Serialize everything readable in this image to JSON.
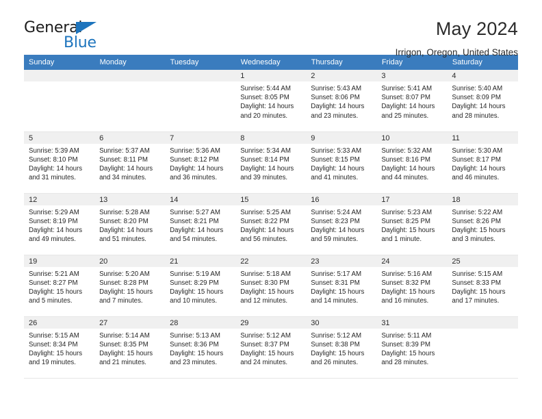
{
  "brand": {
    "name_part1": "General",
    "name_part2": "Blue",
    "accent_color": "#1d74bd"
  },
  "header": {
    "title": "May 2024",
    "subtitle": "Irrigon, Oregon, United States"
  },
  "calendar": {
    "header_bg": "#3a7cbe",
    "weekdays": [
      "Sunday",
      "Monday",
      "Tuesday",
      "Wednesday",
      "Thursday",
      "Friday",
      "Saturday"
    ],
    "weeks": [
      [
        {
          "day": "",
          "empty": true
        },
        {
          "day": "",
          "empty": true
        },
        {
          "day": "",
          "empty": true
        },
        {
          "day": "1",
          "sunrise": "Sunrise: 5:44 AM",
          "sunset": "Sunset: 8:05 PM",
          "daylight1": "Daylight: 14 hours",
          "daylight2": "and 20 minutes."
        },
        {
          "day": "2",
          "sunrise": "Sunrise: 5:43 AM",
          "sunset": "Sunset: 8:06 PM",
          "daylight1": "Daylight: 14 hours",
          "daylight2": "and 23 minutes."
        },
        {
          "day": "3",
          "sunrise": "Sunrise: 5:41 AM",
          "sunset": "Sunset: 8:07 PM",
          "daylight1": "Daylight: 14 hours",
          "daylight2": "and 25 minutes."
        },
        {
          "day": "4",
          "sunrise": "Sunrise: 5:40 AM",
          "sunset": "Sunset: 8:09 PM",
          "daylight1": "Daylight: 14 hours",
          "daylight2": "and 28 minutes."
        }
      ],
      [
        {
          "day": "5",
          "sunrise": "Sunrise: 5:39 AM",
          "sunset": "Sunset: 8:10 PM",
          "daylight1": "Daylight: 14 hours",
          "daylight2": "and 31 minutes."
        },
        {
          "day": "6",
          "sunrise": "Sunrise: 5:37 AM",
          "sunset": "Sunset: 8:11 PM",
          "daylight1": "Daylight: 14 hours",
          "daylight2": "and 34 minutes."
        },
        {
          "day": "7",
          "sunrise": "Sunrise: 5:36 AM",
          "sunset": "Sunset: 8:12 PM",
          "daylight1": "Daylight: 14 hours",
          "daylight2": "and 36 minutes."
        },
        {
          "day": "8",
          "sunrise": "Sunrise: 5:34 AM",
          "sunset": "Sunset: 8:14 PM",
          "daylight1": "Daylight: 14 hours",
          "daylight2": "and 39 minutes."
        },
        {
          "day": "9",
          "sunrise": "Sunrise: 5:33 AM",
          "sunset": "Sunset: 8:15 PM",
          "daylight1": "Daylight: 14 hours",
          "daylight2": "and 41 minutes."
        },
        {
          "day": "10",
          "sunrise": "Sunrise: 5:32 AM",
          "sunset": "Sunset: 8:16 PM",
          "daylight1": "Daylight: 14 hours",
          "daylight2": "and 44 minutes."
        },
        {
          "day": "11",
          "sunrise": "Sunrise: 5:30 AM",
          "sunset": "Sunset: 8:17 PM",
          "daylight1": "Daylight: 14 hours",
          "daylight2": "and 46 minutes."
        }
      ],
      [
        {
          "day": "12",
          "sunrise": "Sunrise: 5:29 AM",
          "sunset": "Sunset: 8:19 PM",
          "daylight1": "Daylight: 14 hours",
          "daylight2": "and 49 minutes."
        },
        {
          "day": "13",
          "sunrise": "Sunrise: 5:28 AM",
          "sunset": "Sunset: 8:20 PM",
          "daylight1": "Daylight: 14 hours",
          "daylight2": "and 51 minutes."
        },
        {
          "day": "14",
          "sunrise": "Sunrise: 5:27 AM",
          "sunset": "Sunset: 8:21 PM",
          "daylight1": "Daylight: 14 hours",
          "daylight2": "and 54 minutes."
        },
        {
          "day": "15",
          "sunrise": "Sunrise: 5:25 AM",
          "sunset": "Sunset: 8:22 PM",
          "daylight1": "Daylight: 14 hours",
          "daylight2": "and 56 minutes."
        },
        {
          "day": "16",
          "sunrise": "Sunrise: 5:24 AM",
          "sunset": "Sunset: 8:23 PM",
          "daylight1": "Daylight: 14 hours",
          "daylight2": "and 59 minutes."
        },
        {
          "day": "17",
          "sunrise": "Sunrise: 5:23 AM",
          "sunset": "Sunset: 8:25 PM",
          "daylight1": "Daylight: 15 hours",
          "daylight2": "and 1 minute."
        },
        {
          "day": "18",
          "sunrise": "Sunrise: 5:22 AM",
          "sunset": "Sunset: 8:26 PM",
          "daylight1": "Daylight: 15 hours",
          "daylight2": "and 3 minutes."
        }
      ],
      [
        {
          "day": "19",
          "sunrise": "Sunrise: 5:21 AM",
          "sunset": "Sunset: 8:27 PM",
          "daylight1": "Daylight: 15 hours",
          "daylight2": "and 5 minutes."
        },
        {
          "day": "20",
          "sunrise": "Sunrise: 5:20 AM",
          "sunset": "Sunset: 8:28 PM",
          "daylight1": "Daylight: 15 hours",
          "daylight2": "and 7 minutes."
        },
        {
          "day": "21",
          "sunrise": "Sunrise: 5:19 AM",
          "sunset": "Sunset: 8:29 PM",
          "daylight1": "Daylight: 15 hours",
          "daylight2": "and 10 minutes."
        },
        {
          "day": "22",
          "sunrise": "Sunrise: 5:18 AM",
          "sunset": "Sunset: 8:30 PM",
          "daylight1": "Daylight: 15 hours",
          "daylight2": "and 12 minutes."
        },
        {
          "day": "23",
          "sunrise": "Sunrise: 5:17 AM",
          "sunset": "Sunset: 8:31 PM",
          "daylight1": "Daylight: 15 hours",
          "daylight2": "and 14 minutes."
        },
        {
          "day": "24",
          "sunrise": "Sunrise: 5:16 AM",
          "sunset": "Sunset: 8:32 PM",
          "daylight1": "Daylight: 15 hours",
          "daylight2": "and 16 minutes."
        },
        {
          "day": "25",
          "sunrise": "Sunrise: 5:15 AM",
          "sunset": "Sunset: 8:33 PM",
          "daylight1": "Daylight: 15 hours",
          "daylight2": "and 17 minutes."
        }
      ],
      [
        {
          "day": "26",
          "sunrise": "Sunrise: 5:15 AM",
          "sunset": "Sunset: 8:34 PM",
          "daylight1": "Daylight: 15 hours",
          "daylight2": "and 19 minutes."
        },
        {
          "day": "27",
          "sunrise": "Sunrise: 5:14 AM",
          "sunset": "Sunset: 8:35 PM",
          "daylight1": "Daylight: 15 hours",
          "daylight2": "and 21 minutes."
        },
        {
          "day": "28",
          "sunrise": "Sunrise: 5:13 AM",
          "sunset": "Sunset: 8:36 PM",
          "daylight1": "Daylight: 15 hours",
          "daylight2": "and 23 minutes."
        },
        {
          "day": "29",
          "sunrise": "Sunrise: 5:12 AM",
          "sunset": "Sunset: 8:37 PM",
          "daylight1": "Daylight: 15 hours",
          "daylight2": "and 24 minutes."
        },
        {
          "day": "30",
          "sunrise": "Sunrise: 5:12 AM",
          "sunset": "Sunset: 8:38 PM",
          "daylight1": "Daylight: 15 hours",
          "daylight2": "and 26 minutes."
        },
        {
          "day": "31",
          "sunrise": "Sunrise: 5:11 AM",
          "sunset": "Sunset: 8:39 PM",
          "daylight1": "Daylight: 15 hours",
          "daylight2": "and 28 minutes."
        },
        {
          "day": "",
          "empty": true
        }
      ]
    ]
  }
}
